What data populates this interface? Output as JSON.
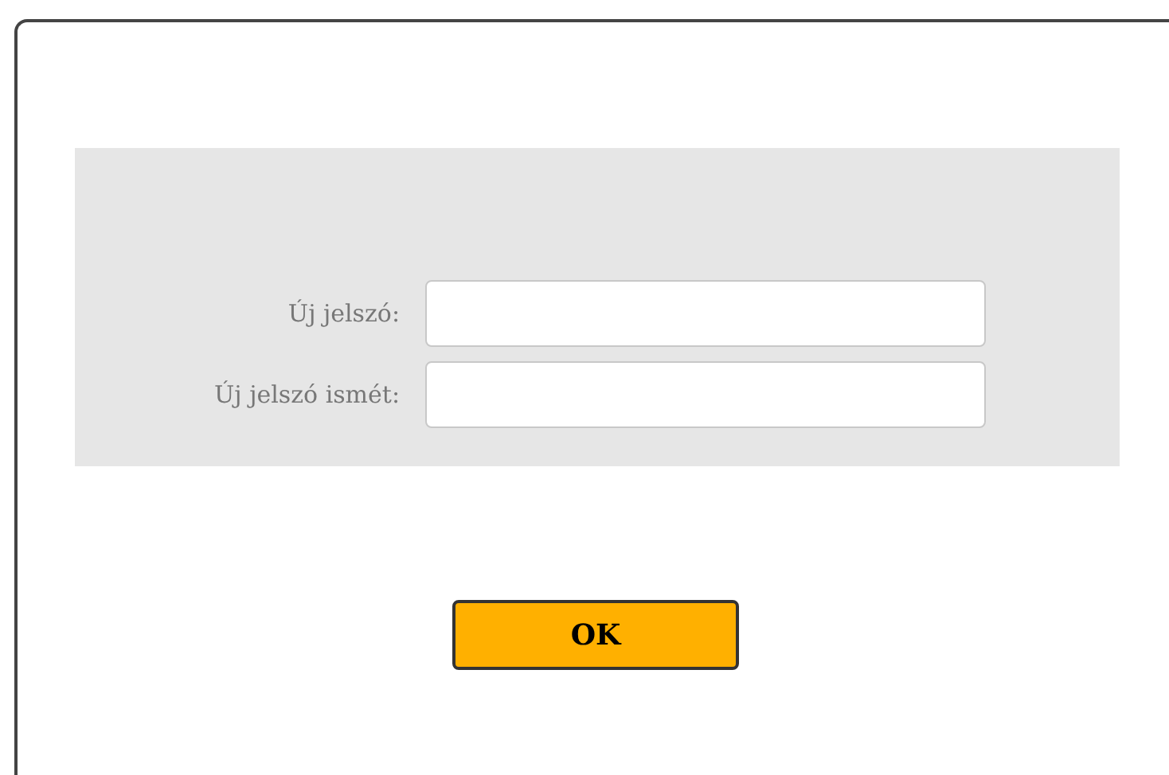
{
  "fields": [
    {
      "label": "Új jelszó:"
    },
    {
      "label": "Új jelszó ismét:"
    }
  ],
  "buttons": [
    "OK"
  ]
}
